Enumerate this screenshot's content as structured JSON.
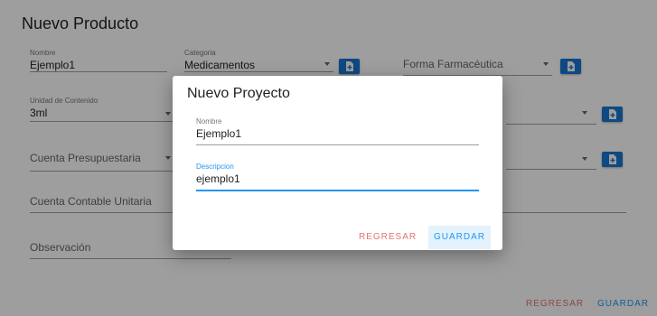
{
  "page": {
    "title": "Nuevo Producto",
    "fields": {
      "nombre": {
        "label": "Nombre",
        "value": "Ejemplo1"
      },
      "categoria": {
        "label": "Categoria",
        "value": "Medicamentos"
      },
      "forma_farmaceutica": {
        "placeholder": "Forma Farmacéutica"
      },
      "unidad_contenido": {
        "label": "Unidad de Contenido",
        "value": "3ml"
      },
      "cuenta_presupuestaria": {
        "placeholder": "Cuenta Presupuestaria"
      },
      "cuenta_contable": {
        "placeholder": "Cuenta Contable Unitaria"
      },
      "observacion": {
        "placeholder": "Observación"
      }
    },
    "footer": {
      "regresar": "REGRESAR",
      "guardar": "GUARDAR"
    }
  },
  "dialog": {
    "title": "Nuevo Proyecto",
    "nombre": {
      "label": "Nombre",
      "value": "Ejemplo1"
    },
    "descripcion": {
      "label": "Descripcion",
      "value": "ejemplo1"
    },
    "regresar": "REGRESAR",
    "guardar": "GUARDAR"
  },
  "colors": {
    "primary": "#1976d2",
    "accent": "#2196f3",
    "danger": "#e57373",
    "overlay": "rgba(0,0,0,0.38)"
  }
}
